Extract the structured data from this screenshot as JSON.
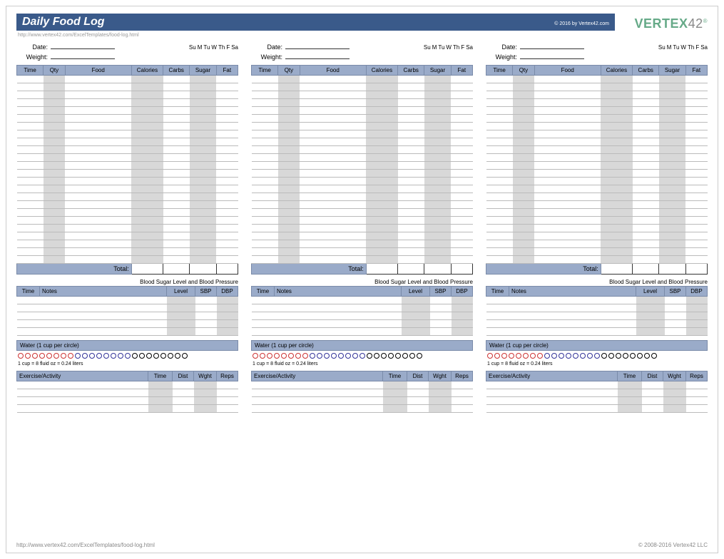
{
  "header": {
    "title": "Daily Food Log",
    "copyright": "© 2016 by Vertex42.com",
    "url": "http://www.vertex42.com/ExcelTemplates/food-log.html",
    "logo_text": "VERTEX",
    "logo_num": "42"
  },
  "meta": {
    "date_label": "Date:",
    "weight_label": "Weight:",
    "days": [
      "Su",
      "M",
      "Tu",
      "W",
      "Th",
      "F",
      "Sa"
    ]
  },
  "food": {
    "headers": [
      "Time",
      "Qty",
      "Food",
      "Calories",
      "Carbs",
      "Sugar",
      "Fat"
    ],
    "rows": 24,
    "total_label": "Total:"
  },
  "bp": {
    "section_title": "Blood Sugar Level and Blood Pressure",
    "headers": [
      "Time",
      "Notes",
      "Level",
      "SBP",
      "DBP"
    ],
    "rows": 5
  },
  "water": {
    "header": "Water (1 cup per circle)",
    "note": "1 cup = 8 fluid oz = 0.24 liters",
    "red_count": 8,
    "blue_count": 8,
    "black_count": 8
  },
  "exercise": {
    "headers": [
      "Exercise/Activity",
      "Time",
      "Dist",
      "Wght",
      "Reps"
    ],
    "rows": 4
  },
  "footer": {
    "url": "http://www.vertex42.com/ExcelTemplates/food-log.html",
    "copyright": "© 2008-2016 Vertex42 LLC"
  }
}
